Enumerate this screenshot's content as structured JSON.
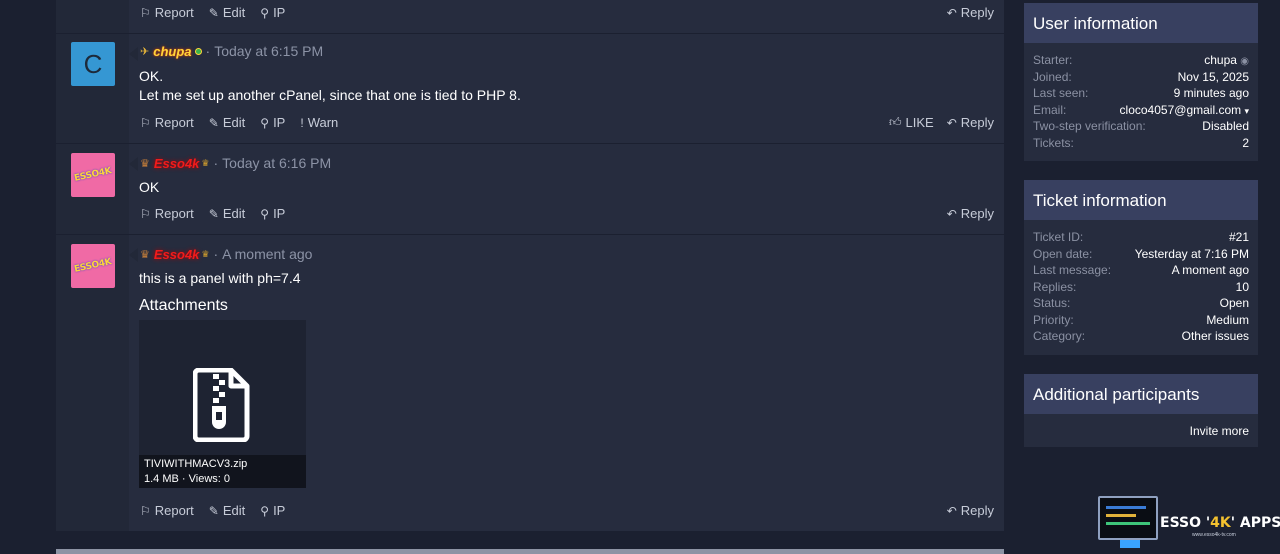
{
  "posts": [
    {
      "actions": {
        "report": "Report",
        "edit": "Edit",
        "ip": "IP",
        "reply": "Reply"
      }
    },
    {
      "avatar_letter": "C",
      "username": "chupa",
      "time": "Today at 6:15 PM",
      "lines": [
        "OK.",
        "Let me set up another cPanel, since that one is tied to PHP 8."
      ],
      "actions": {
        "report": "Report",
        "edit": "Edit",
        "ip": "IP",
        "warn": "Warn",
        "like": "LIKE",
        "reply": "Reply"
      }
    },
    {
      "avatar_logo": "ESSO4K",
      "username": "Esso4k",
      "time": "Today at 6:16 PM",
      "lines": [
        "OK"
      ],
      "actions": {
        "report": "Report",
        "edit": "Edit",
        "ip": "IP",
        "reply": "Reply"
      }
    },
    {
      "avatar_logo": "ESSO4K",
      "username": "Esso4k",
      "time": "A moment ago",
      "lines": [
        "this is a panel with ph=7.4"
      ],
      "attachments_title": "Attachments",
      "attachment": {
        "filename": "TIVIWITHMACV3.zip",
        "info": "1.4 MB · Views: 0"
      },
      "actions": {
        "report": "Report",
        "edit": "Edit",
        "ip": "IP",
        "reply": "Reply"
      }
    }
  ],
  "sidebar": {
    "user_info": {
      "title": "User information",
      "rows": [
        {
          "k": "Starter:",
          "v": "chupa"
        },
        {
          "k": "Joined:",
          "v": "Nov 15, 2025"
        },
        {
          "k": "Last seen:",
          "v": "9 minutes ago"
        },
        {
          "k": "Email:",
          "v": "cloco4057@gmail.com"
        },
        {
          "k": "Two-step verification:",
          "v": "Disabled"
        },
        {
          "k": "Tickets:",
          "v": "2"
        }
      ]
    },
    "ticket_info": {
      "title": "Ticket information",
      "rows": [
        {
          "k": "Ticket ID:",
          "v": "#21"
        },
        {
          "k": "Open date:",
          "v": "Yesterday at 7:16 PM"
        },
        {
          "k": "Last message:",
          "v": "A moment ago"
        },
        {
          "k": "Replies:",
          "v": "10"
        },
        {
          "k": "Status:",
          "v": "Open"
        },
        {
          "k": "Priority:",
          "v": "Medium"
        },
        {
          "k": "Category:",
          "v": "Other issues"
        }
      ]
    },
    "participants": {
      "title": "Additional participants",
      "invite": "Invite more"
    }
  },
  "brand": {
    "name_pre": "ESSO '",
    "name_accent": "4K",
    "name_post": "' APPS",
    "url": "www.esso4k-tv.com"
  },
  "icons": {
    "report": "flag-icon",
    "edit": "edit-icon",
    "ip": "search-icon",
    "warn": "warn-icon",
    "like": "thumbs-up-icon",
    "reply": "reply-icon",
    "file": "zip-file-icon"
  }
}
